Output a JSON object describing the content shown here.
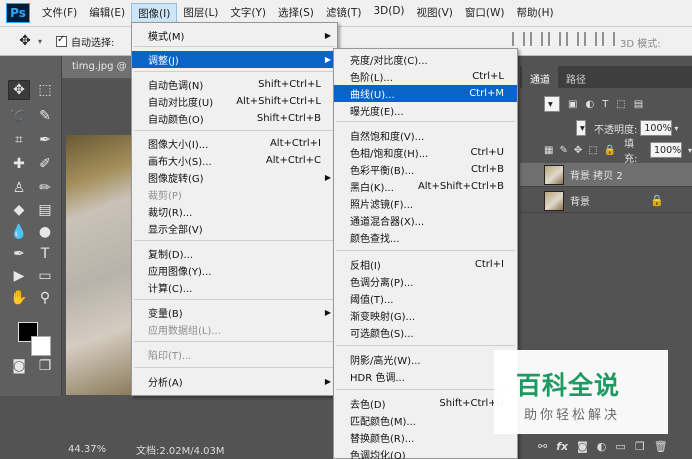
{
  "menubar": {
    "logo": "Ps",
    "items": [
      "文件(F)",
      "编辑(E)",
      "图像(I)",
      "图层(L)",
      "文字(Y)",
      "选择(S)",
      "滤镜(T)",
      "3D(D)",
      "视图(V)",
      "窗口(W)",
      "帮助(H)"
    ],
    "active_index": 2
  },
  "optbar": {
    "auto_select_label": "自动选择:",
    "mode_3d_label": "3D 模式:"
  },
  "document": {
    "tab_title": "timg.jpg @",
    "zoom": "44.37%",
    "doc_size": "文档:2.02M/4.03M"
  },
  "image_menu": {
    "items": [
      {
        "label": "模式(M)",
        "shortcut": "",
        "submenu": true,
        "disabled": false
      },
      {
        "label": "调整(J)",
        "shortcut": "",
        "submenu": true,
        "disabled": false,
        "highlight": true
      },
      {
        "label": "自动色调(N)",
        "shortcut": "Shift+Ctrl+L",
        "disabled": false
      },
      {
        "label": "自动对比度(U)",
        "shortcut": "Alt+Shift+Ctrl+L",
        "disabled": false
      },
      {
        "label": "自动颜色(O)",
        "shortcut": "Shift+Ctrl+B",
        "disabled": false
      },
      {
        "label": "图像大小(I)...",
        "shortcut": "Alt+Ctrl+I",
        "disabled": false
      },
      {
        "label": "画布大小(S)...",
        "shortcut": "Alt+Ctrl+C",
        "disabled": false
      },
      {
        "label": "图像旋转(G)",
        "shortcut": "",
        "submenu": true,
        "disabled": false
      },
      {
        "label": "裁剪(P)",
        "shortcut": "",
        "disabled": true
      },
      {
        "label": "裁切(R)...",
        "shortcut": "",
        "disabled": false
      },
      {
        "label": "显示全部(V)",
        "shortcut": "",
        "disabled": false
      },
      {
        "label": "复制(D)...",
        "shortcut": "",
        "disabled": false
      },
      {
        "label": "应用图像(Y)...",
        "shortcut": "",
        "disabled": false
      },
      {
        "label": "计算(C)...",
        "shortcut": "",
        "disabled": false
      },
      {
        "label": "变量(B)",
        "shortcut": "",
        "submenu": true,
        "disabled": false
      },
      {
        "label": "应用数据组(L)...",
        "shortcut": "",
        "disabled": true
      },
      {
        "label": "陷印(T)...",
        "shortcut": "",
        "disabled": true
      },
      {
        "label": "分析(A)",
        "shortcut": "",
        "submenu": true,
        "disabled": false
      }
    ]
  },
  "adjust_menu": {
    "items": [
      {
        "label": "亮度/对比度(C)...",
        "shortcut": ""
      },
      {
        "label": "色阶(L)...",
        "shortcut": "Ctrl+L"
      },
      {
        "label": "曲线(U)...",
        "shortcut": "Ctrl+M",
        "highlight": true
      },
      {
        "label": "曝光度(E)...",
        "shortcut": ""
      },
      {
        "label": "自然饱和度(V)...",
        "shortcut": ""
      },
      {
        "label": "色相/饱和度(H)...",
        "shortcut": "Ctrl+U"
      },
      {
        "label": "色彩平衡(B)...",
        "shortcut": "Ctrl+B"
      },
      {
        "label": "黑白(K)...",
        "shortcut": "Alt+Shift+Ctrl+B"
      },
      {
        "label": "照片滤镜(F)...",
        "shortcut": ""
      },
      {
        "label": "通道混合器(X)...",
        "shortcut": ""
      },
      {
        "label": "颜色查找...",
        "shortcut": ""
      },
      {
        "label": "反相(I)",
        "shortcut": "Ctrl+I"
      },
      {
        "label": "色调分离(P)...",
        "shortcut": ""
      },
      {
        "label": "阈值(T)...",
        "shortcut": ""
      },
      {
        "label": "渐变映射(G)...",
        "shortcut": ""
      },
      {
        "label": "可选颜色(S)...",
        "shortcut": ""
      },
      {
        "label": "阴影/高光(W)...",
        "shortcut": ""
      },
      {
        "label": "HDR 色调...",
        "shortcut": ""
      },
      {
        "label": "去色(D)",
        "shortcut": "Shift+Ctrl+U"
      },
      {
        "label": "匹配颜色(M)...",
        "shortcut": ""
      },
      {
        "label": "替换颜色(R)...",
        "shortcut": ""
      },
      {
        "label": "色调均化(Q)",
        "shortcut": ""
      }
    ]
  },
  "panels": {
    "tabs": [
      "通道",
      "路径"
    ],
    "opacity_label": "不透明度:",
    "opacity_value": "100%",
    "fill_label": "填充:",
    "fill_value": "100%",
    "lock_label": "锁定:",
    "layers": [
      {
        "name": "背景 拷贝 2",
        "selected": true
      },
      {
        "name": "背景",
        "selected": false,
        "locked": true
      }
    ]
  },
  "watermark": {
    "big": "百科全说",
    "small": "助你轻松解决"
  },
  "colors": {
    "menu_highlight": "#0a64c8",
    "watermark_green": "#1d9a62"
  }
}
